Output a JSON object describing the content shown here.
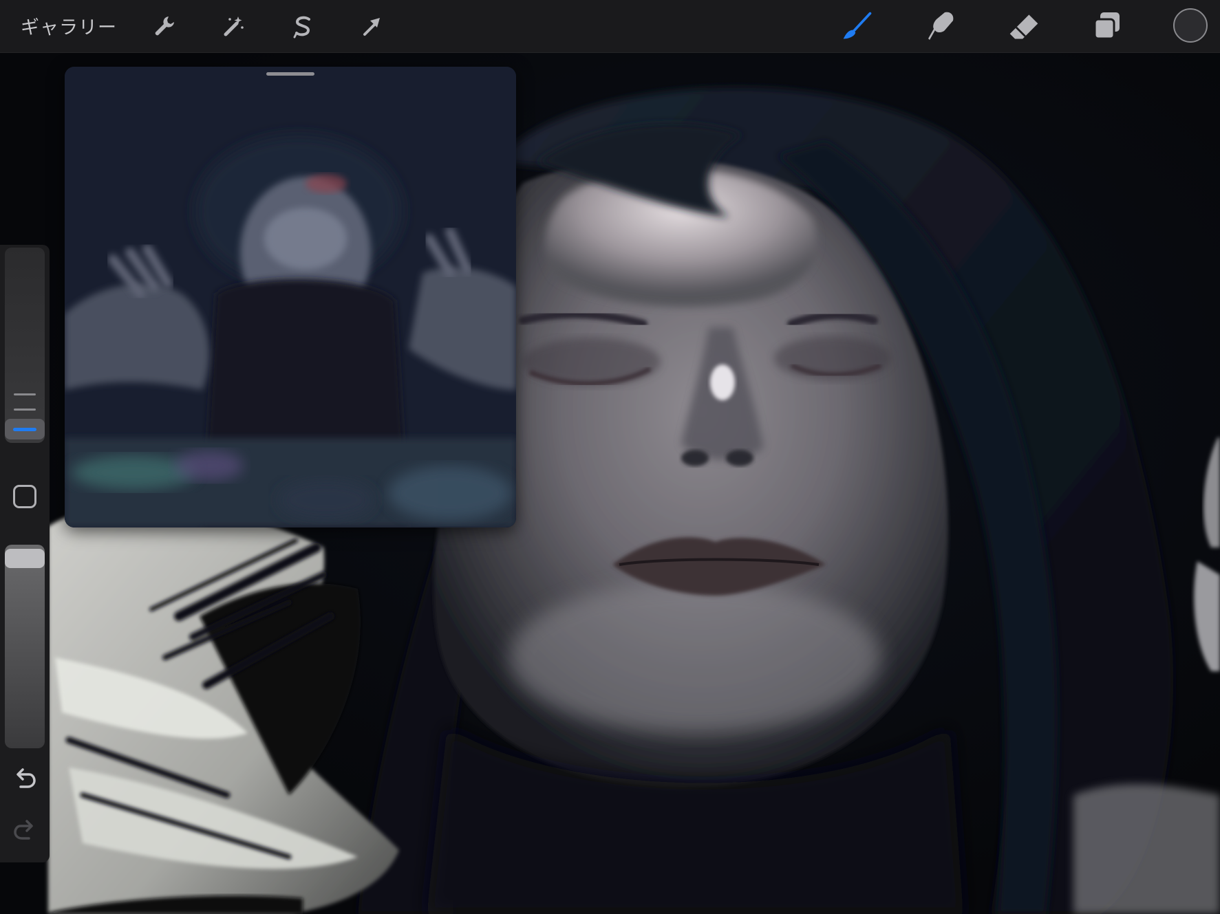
{
  "toolbar": {
    "gallery_label": "ギャラリー",
    "left_tools": [
      {
        "name": "actions",
        "icon": "wrench-icon"
      },
      {
        "name": "adjustments",
        "icon": "magic-wand-icon"
      },
      {
        "name": "selection",
        "icon": "selection-s-icon"
      },
      {
        "name": "transform",
        "icon": "arrow-cursor-icon"
      }
    ],
    "right_tools": [
      {
        "name": "brush",
        "icon": "brush-icon",
        "active": true
      },
      {
        "name": "smudge",
        "icon": "smudge-finger-icon",
        "active": false
      },
      {
        "name": "eraser",
        "icon": "eraser-icon",
        "active": false
      },
      {
        "name": "layers",
        "icon": "layers-icon",
        "active": false
      }
    ],
    "current_color": "#2c2c2f"
  },
  "sidebar": {
    "brush_size_icon": "size-slider",
    "opacity_icon": "opacity-slider",
    "modify_icon": "square-icon",
    "undo_icon": "undo-arrow-icon",
    "redo_icon": "redo-arrow-icon"
  },
  "colors": {
    "accent": "#1f7cf2",
    "toolbar_bg": "#1a1a1c",
    "icon_gray": "#b5b5b9"
  }
}
